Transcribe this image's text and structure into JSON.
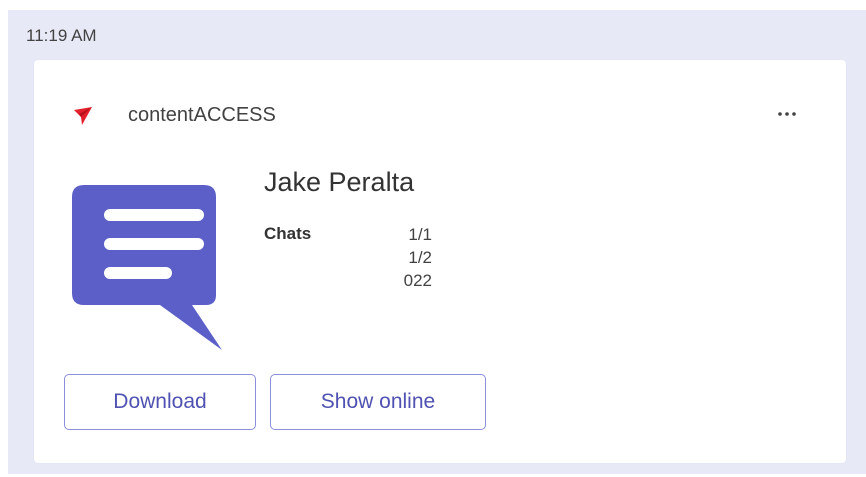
{
  "message": {
    "timestamp": "11:19 AM"
  },
  "card": {
    "app_name": "contentACCESS",
    "more_icon": "more-options-icon",
    "app_logo_icon": "paper-plane-logo",
    "illustration_icon": "chat-bubble-icon",
    "contact_name": "Jake Peralta",
    "facts": [
      {
        "label": "Chats",
        "value_lines": [
          "1/1",
          "1/2",
          "022"
        ]
      }
    ],
    "actions": {
      "download_label": "Download",
      "show_online_label": "Show online"
    }
  },
  "colors": {
    "background": "#e8e9f6",
    "accent": "#5b5fc7",
    "button_text": "#4f52b2",
    "logo_red": "#e3212d"
  }
}
